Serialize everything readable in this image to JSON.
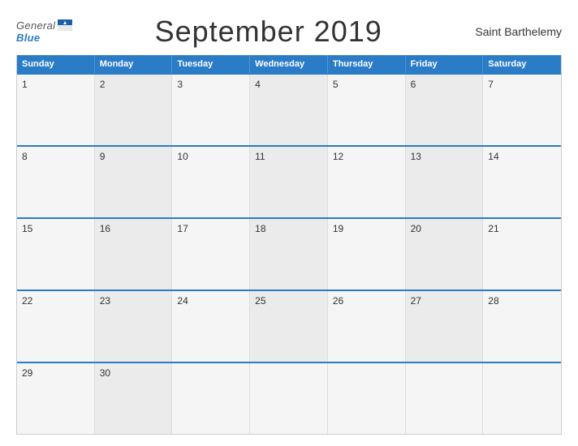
{
  "header": {
    "logo_general": "General",
    "logo_blue": "Blue",
    "title": "September 2019",
    "country": "Saint Barthelemy"
  },
  "weekdays": [
    "Sunday",
    "Monday",
    "Tuesday",
    "Wednesday",
    "Thursday",
    "Friday",
    "Saturday"
  ],
  "weeks": [
    [
      {
        "num": "1",
        "empty": false
      },
      {
        "num": "2",
        "empty": false
      },
      {
        "num": "3",
        "empty": false
      },
      {
        "num": "4",
        "empty": false
      },
      {
        "num": "5",
        "empty": false
      },
      {
        "num": "6",
        "empty": false
      },
      {
        "num": "7",
        "empty": false
      }
    ],
    [
      {
        "num": "8",
        "empty": false
      },
      {
        "num": "9",
        "empty": false
      },
      {
        "num": "10",
        "empty": false
      },
      {
        "num": "11",
        "empty": false
      },
      {
        "num": "12",
        "empty": false
      },
      {
        "num": "13",
        "empty": false
      },
      {
        "num": "14",
        "empty": false
      }
    ],
    [
      {
        "num": "15",
        "empty": false
      },
      {
        "num": "16",
        "empty": false
      },
      {
        "num": "17",
        "empty": false
      },
      {
        "num": "18",
        "empty": false
      },
      {
        "num": "19",
        "empty": false
      },
      {
        "num": "20",
        "empty": false
      },
      {
        "num": "21",
        "empty": false
      }
    ],
    [
      {
        "num": "22",
        "empty": false
      },
      {
        "num": "23",
        "empty": false
      },
      {
        "num": "24",
        "empty": false
      },
      {
        "num": "25",
        "empty": false
      },
      {
        "num": "26",
        "empty": false
      },
      {
        "num": "27",
        "empty": false
      },
      {
        "num": "28",
        "empty": false
      }
    ],
    [
      {
        "num": "29",
        "empty": false
      },
      {
        "num": "30",
        "empty": false
      },
      {
        "num": "",
        "empty": true
      },
      {
        "num": "",
        "empty": true
      },
      {
        "num": "",
        "empty": true
      },
      {
        "num": "",
        "empty": true
      },
      {
        "num": "",
        "empty": true
      }
    ]
  ]
}
